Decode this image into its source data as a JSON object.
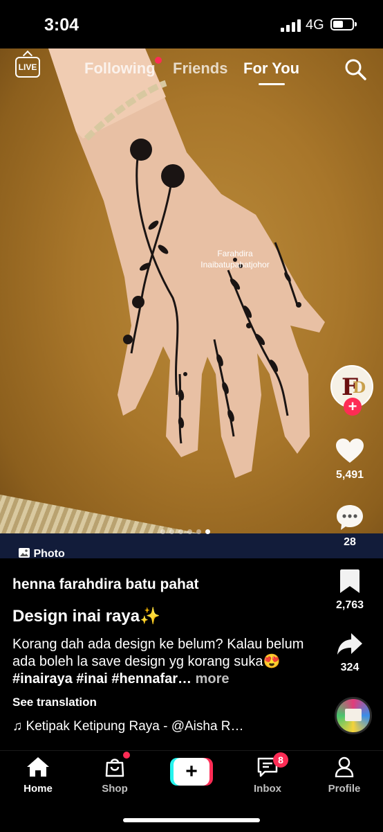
{
  "status_bar": {
    "time": "3:04",
    "network": "4G"
  },
  "top_nav": {
    "tabs": [
      "Following",
      "Friends",
      "For You"
    ],
    "active_tab": "For You",
    "live_label": "LIVE"
  },
  "post": {
    "watermark_line1": "Farahdira",
    "watermark_line2": "Inaibatupahatjohor",
    "media_type": "Photo",
    "photo_count": 6,
    "current_photo": 6,
    "author": "henna farahdira batu pahat",
    "title": "Design inai raya✨",
    "description": "Korang dah ada design ke belum? Kalau belum ada boleh la save design yg korang suka😍 ",
    "hashtags": "#inairaya #inai #hennafar…",
    "more_label": " more",
    "see_translation": "See translation",
    "music": "Ketipak Ketipung Raya - @Aisha R…"
  },
  "actions": {
    "likes": "5,491",
    "comments": "28",
    "saves": "2,763",
    "shares": "324"
  },
  "bottom_nav": {
    "home": "Home",
    "shop": "Shop",
    "inbox": "Inbox",
    "inbox_badge": "8",
    "profile": "Profile"
  },
  "colors": {
    "accent": "#fe2c55",
    "cyan": "#25f4ee",
    "background": "#000000"
  }
}
